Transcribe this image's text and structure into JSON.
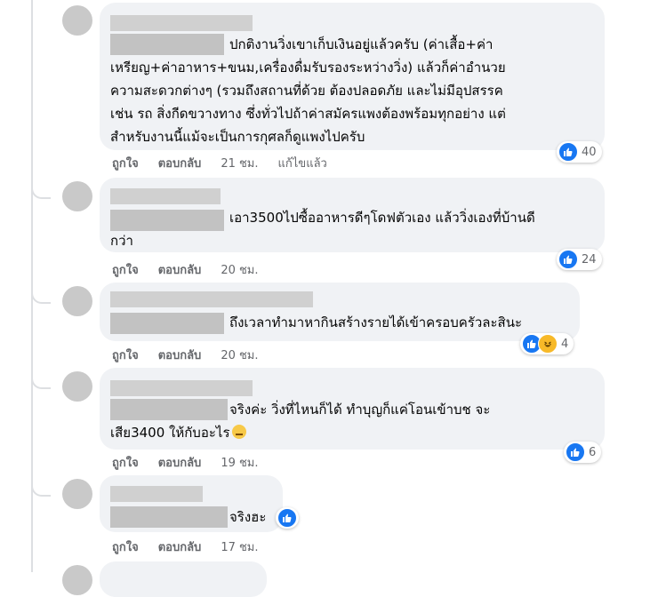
{
  "comments": [
    {
      "text_lines": [
        "ปกติงานวิ่งเขาเก็บเงินอยู่แล้วครับ (ค่าเสื้อ+ค่า",
        "เหรียญ+ค่าอาหาร+ขนม,เครื่องดื่มรับรองระหว่างวิ่ง) แล้วก็ค่าอำนวย",
        "ความสะดวกต่างๆ (รวมถึงสถานที่ด้วย ต้องปลอดภัย และไม่มีอุปสรรค",
        "เช่น รถ สิ่งกีดขวางทาง ซึ่งทั่วไปถ้าค่าสมัครแพงต้องพร้อมทุกอย่าง แต่",
        "สำหรับงานนี้แม้จะเป็นการกุศลก็ดูแพงไปครับ"
      ],
      "like_label": "ถูกใจ",
      "reply_label": "ตอบกลับ",
      "time": "21 ชม.",
      "edited": "แก้ไขแล้ว",
      "reaction_count": "40",
      "reaction_icons": [
        "like-icon"
      ]
    },
    {
      "text_lines": [
        "เอา3500ไปซื้ออาหารดีๆโดฟตัวเอง แล้ววิ่งเองที่บ้านดี",
        "กว่า"
      ],
      "like_label": "ถูกใจ",
      "reply_label": "ตอบกลับ",
      "time": "20 ชม.",
      "reaction_count": "24",
      "reaction_icons": [
        "like-icon"
      ]
    },
    {
      "text_lines": [
        "ถึงเวลาทำมาหากินสร้างรายได้เข้าครอบครัวละสินะ"
      ],
      "like_label": "ถูกใจ",
      "reply_label": "ตอบกลับ",
      "time": "20 ชม.",
      "reaction_count": "4",
      "reaction_icons": [
        "like-icon",
        "haha-icon"
      ]
    },
    {
      "text_lines": [
        "จริงค่ะ วิ่งที่ไหนก็ได้ ทำบุญก็แค่โอนเข้าบช จะ",
        "เสีย3400 ให้กับอะไร"
      ],
      "like_label": "ถูกใจ",
      "reply_label": "ตอบกลับ",
      "time": "19 ชม.",
      "reaction_count": "6",
      "reaction_icons": [
        "like-icon",
        "rolling-eyes-emoji"
      ]
    },
    {
      "text_lines": [
        "จริงฮะ"
      ],
      "like_label": "ถูกใจ",
      "reply_label": "ตอบกลับ",
      "time": "17 ชม.",
      "reaction_count": "",
      "reaction_icons": [
        "like-icon"
      ]
    }
  ],
  "colors": {
    "bubble_bg": "#f0f2f5",
    "like_blue": "#1877f2",
    "meta_gray": "#65676b",
    "avatar_gray": "#c9c9c9",
    "redaction_gray": "#c2c2c2"
  }
}
